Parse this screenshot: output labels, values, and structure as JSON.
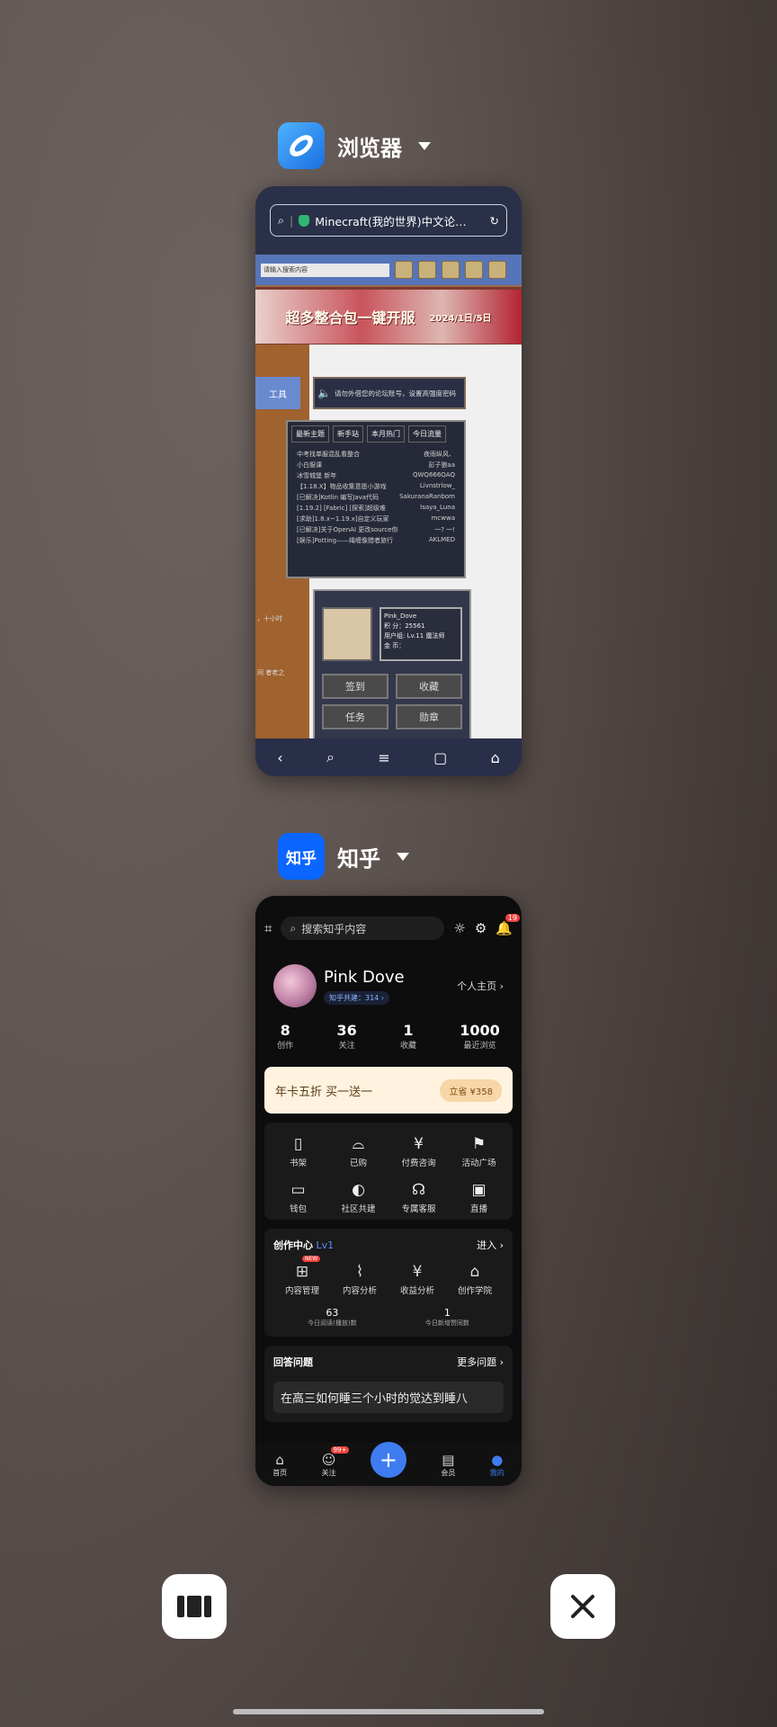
{
  "apps": [
    {
      "name": "浏览器",
      "url_display": "Minecraft(我的世界)中文论…",
      "mc": {
        "search_placeholder": "请输入搜索内容",
        "banner": "超多整合包一键开服",
        "banner_date": "2024/1日/5日",
        "notice": "请勿外借您的论坛账号，设置高强度密码",
        "tabs": [
          "最新主题",
          "新手站",
          "本月热门",
          "今日流量"
        ],
        "threads": [
          {
            "title": "中考找单服混乱看整合",
            "author": "夜雨纵风、"
          },
          {
            "title": "小白服课",
            "author": "彭子狼aa"
          },
          {
            "title": "冰雪城堡 新年",
            "author": "QWQ666QAQ"
          },
          {
            "title": "【1.18.X】物品收集意愿小游戏",
            "author": "Livnstrlow_"
          },
          {
            "title": "[已解决]Kotlin 编写Java代码",
            "author": "SakuranaRanbom"
          },
          {
            "title": "[1.19.2] [Fabric] [探索]超级难",
            "author": "Isaya_Luna"
          },
          {
            "title": "[求助]1.8.x~1.19.x]自定义玩家",
            "author": "mcwwa"
          },
          {
            "title": "[已解决]关于OpenAI 更改source你",
            "author": "一? 一!"
          },
          {
            "title": "[娱乐]Potting——绳缠像猎者旅行",
            "author": "AKLMED"
          }
        ],
        "user_name": "Pink_Dove",
        "user_points": "积 分：25561",
        "user_line3": "用户组: Lv.11 魔法师",
        "user_line4": "金 币：",
        "btn_signin": "签到",
        "btn_fav": "收藏",
        "btn_task": "任务",
        "btn_medal": "勋章",
        "left_frag1": "工具",
        "left_frag2": "，十小时",
        "left_frag3": "间 者老之"
      }
    },
    {
      "name": "知乎",
      "icon_text": "知乎",
      "search_placeholder": "搜索知乎内容",
      "notif_count": "19",
      "profile_name": "Pink Dove",
      "profile_sub": "知乎共建：314 ›",
      "profile_link": "个人主页 ›",
      "stats": [
        {
          "value": "8",
          "label": "创作"
        },
        {
          "value": "36",
          "label": "关注"
        },
        {
          "value": "1",
          "label": "收藏"
        },
        {
          "value": "1000",
          "label": "最近浏览"
        }
      ],
      "promo_text": "年卡五折 买一送一",
      "promo_button": "立省 ¥358",
      "grid": [
        {
          "icon": "book-icon",
          "glyph": "▯",
          "label": "书架"
        },
        {
          "icon": "bag-icon",
          "glyph": "⌓",
          "label": "已购"
        },
        {
          "icon": "yuan-icon",
          "glyph": "¥",
          "label": "付费咨询"
        },
        {
          "icon": "flag-icon",
          "glyph": "⚑",
          "label": "活动广场"
        },
        {
          "icon": "wallet-icon",
          "glyph": "▭",
          "label": "钱包"
        },
        {
          "icon": "leaf-icon",
          "glyph": "◐",
          "label": "社区共建"
        },
        {
          "icon": "headset-icon",
          "glyph": "☊",
          "label": "专属客服"
        },
        {
          "icon": "tv-icon",
          "glyph": "▣",
          "label": "直播"
        }
      ],
      "creator_title": "创作中心",
      "creator_level": "Lv1",
      "creator_enter": "进入 ›",
      "creator_items": [
        {
          "icon": "grid-icon",
          "glyph": "⊞",
          "label": "内容管理",
          "new": "NEW"
        },
        {
          "icon": "chart-icon",
          "glyph": "⌇",
          "label": "内容分析"
        },
        {
          "icon": "moneybag-icon",
          "glyph": "¥",
          "label": "收益分析"
        },
        {
          "icon": "cap-icon",
          "glyph": "⌂",
          "label": "创作学院"
        }
      ],
      "today": [
        {
          "value": "63",
          "label": "今日阅读(播放)数"
        },
        {
          "value": "1",
          "label": "今日新增赞同数"
        }
      ],
      "answer_title": "回答问题",
      "answer_more": "更多问题 ›",
      "question": "在高三如何睡三个小时的觉达到睡八",
      "tabs": [
        {
          "label": "首页",
          "glyph": "⌂"
        },
        {
          "label": "关注",
          "glyph": "☺",
          "bubble": "99+"
        },
        {
          "label": "会员",
          "glyph": "▤"
        },
        {
          "label": "我的",
          "glyph": "●"
        }
      ]
    }
  ],
  "colors": {
    "accent": "#3f7cf0",
    "badge": "#f0433e"
  }
}
